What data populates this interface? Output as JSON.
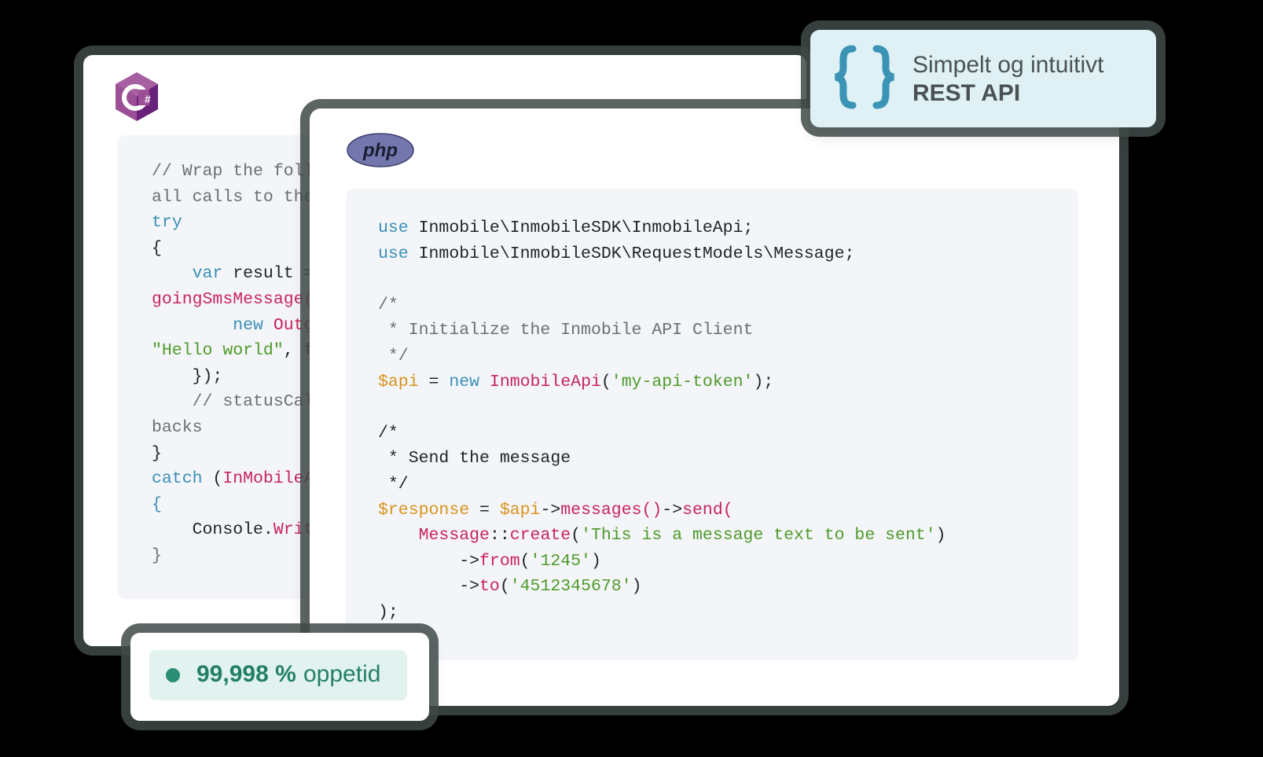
{
  "colors": {
    "keyword": "#3a8fb7",
    "variable": "#d9941e",
    "function": "#c8245c",
    "string": "#4f9a2a",
    "comment": "#6b6f75",
    "uptime_green": "#237f66",
    "rest_bg": "#dff1f5"
  },
  "csharp": {
    "logo_icon": "csharp-logo-icon",
    "lines": [
      [
        {
          "t": "comment",
          "v": "// Wrap the foll"
        }
      ],
      [
        {
          "t": "comment",
          "v": "all calls to the"
        }
      ],
      [
        {
          "t": "kw",
          "v": "try"
        }
      ],
      [
        {
          "t": "punct",
          "v": "{"
        }
      ],
      [
        {
          "t": "plain",
          "v": "    "
        },
        {
          "t": "kw",
          "v": "var"
        },
        {
          "t": "plain",
          "v": " result ="
        }
      ],
      [
        {
          "t": "fn",
          "v": "goingSmsMessage("
        }
      ],
      [
        {
          "t": "plain",
          "v": "        "
        },
        {
          "t": "kw",
          "v": "new"
        },
        {
          "t": "plain",
          "v": " "
        },
        {
          "t": "fn",
          "v": "Outg"
        }
      ],
      [
        {
          "t": "str",
          "v": "\"Hello world\""
        },
        {
          "t": "plain",
          "v": ", f"
        }
      ],
      [
        {
          "t": "plain",
          "v": "    });"
        }
      ],
      [
        {
          "t": "comment",
          "v": "    // statusCal"
        }
      ],
      [
        {
          "t": "comment",
          "v": "backs"
        }
      ],
      [
        {
          "t": "punct",
          "v": "}"
        }
      ],
      [
        {
          "t": "kw",
          "v": "catch"
        },
        {
          "t": "plain",
          "v": " ("
        },
        {
          "t": "fn",
          "v": "InMobileA"
        }
      ],
      [
        {
          "t": "kw",
          "v": "{"
        }
      ],
      [
        {
          "t": "plain",
          "v": "    Console."
        },
        {
          "t": "fn",
          "v": "Writ"
        }
      ],
      [
        {
          "t": "comment",
          "v": "}"
        }
      ]
    ]
  },
  "php": {
    "logo_text": "php",
    "lines": [
      [
        {
          "t": "kw",
          "v": "use"
        },
        {
          "t": "plain",
          "v": " Inmobile\\InmobileSDK\\InmobileApi;"
        }
      ],
      [
        {
          "t": "kw",
          "v": "use"
        },
        {
          "t": "plain",
          "v": " Inmobile\\InmobileSDK\\RequestModels\\Message;"
        }
      ],
      [],
      [
        {
          "t": "comment",
          "v": "/*"
        }
      ],
      [
        {
          "t": "comment",
          "v": " * Initialize the Inmobile API Client"
        }
      ],
      [
        {
          "t": "comment",
          "v": " */"
        }
      ],
      [
        {
          "t": "var",
          "v": "$api"
        },
        {
          "t": "plain",
          "v": " = "
        },
        {
          "t": "kw",
          "v": "new"
        },
        {
          "t": "plain",
          "v": " "
        },
        {
          "t": "fn",
          "v": "InmobileApi"
        },
        {
          "t": "plain",
          "v": "("
        },
        {
          "t": "str",
          "v": "'my-api-token'"
        },
        {
          "t": "plain",
          "v": ");"
        }
      ],
      [],
      [
        {
          "t": "plain",
          "v": "/*"
        }
      ],
      [
        {
          "t": "plain",
          "v": " * Send the message"
        }
      ],
      [
        {
          "t": "plain",
          "v": " */"
        }
      ],
      [
        {
          "t": "var",
          "v": "$response"
        },
        {
          "t": "plain",
          "v": " = "
        },
        {
          "t": "var",
          "v": "$api"
        },
        {
          "t": "plain",
          "v": "->"
        },
        {
          "t": "fn",
          "v": "messages()"
        },
        {
          "t": "plain",
          "v": "->"
        },
        {
          "t": "fn",
          "v": "send("
        }
      ],
      [
        {
          "t": "plain",
          "v": "    "
        },
        {
          "t": "fn",
          "v": "Message"
        },
        {
          "t": "plain",
          "v": "::"
        },
        {
          "t": "fn",
          "v": "create"
        },
        {
          "t": "plain",
          "v": "("
        },
        {
          "t": "str",
          "v": "'This is a message text to be sent'"
        },
        {
          "t": "plain",
          "v": ")"
        }
      ],
      [
        {
          "t": "plain",
          "v": "        ->"
        },
        {
          "t": "fn",
          "v": "from"
        },
        {
          "t": "plain",
          "v": "("
        },
        {
          "t": "str",
          "v": "'1245'"
        },
        {
          "t": "plain",
          "v": ")"
        }
      ],
      [
        {
          "t": "plain",
          "v": "        ->"
        },
        {
          "t": "fn",
          "v": "to"
        },
        {
          "t": "plain",
          "v": "("
        },
        {
          "t": "str",
          "v": "'4512345678'"
        },
        {
          "t": "plain",
          "v": ")"
        }
      ],
      [
        {
          "t": "plain",
          "v": ");"
        }
      ]
    ]
  },
  "rest_callout": {
    "icon": "curly-braces-icon",
    "line1": "Simpelt og intuitivt",
    "line2": "REST API"
  },
  "uptime": {
    "value": "99,998 %",
    "label": "oppetid"
  }
}
